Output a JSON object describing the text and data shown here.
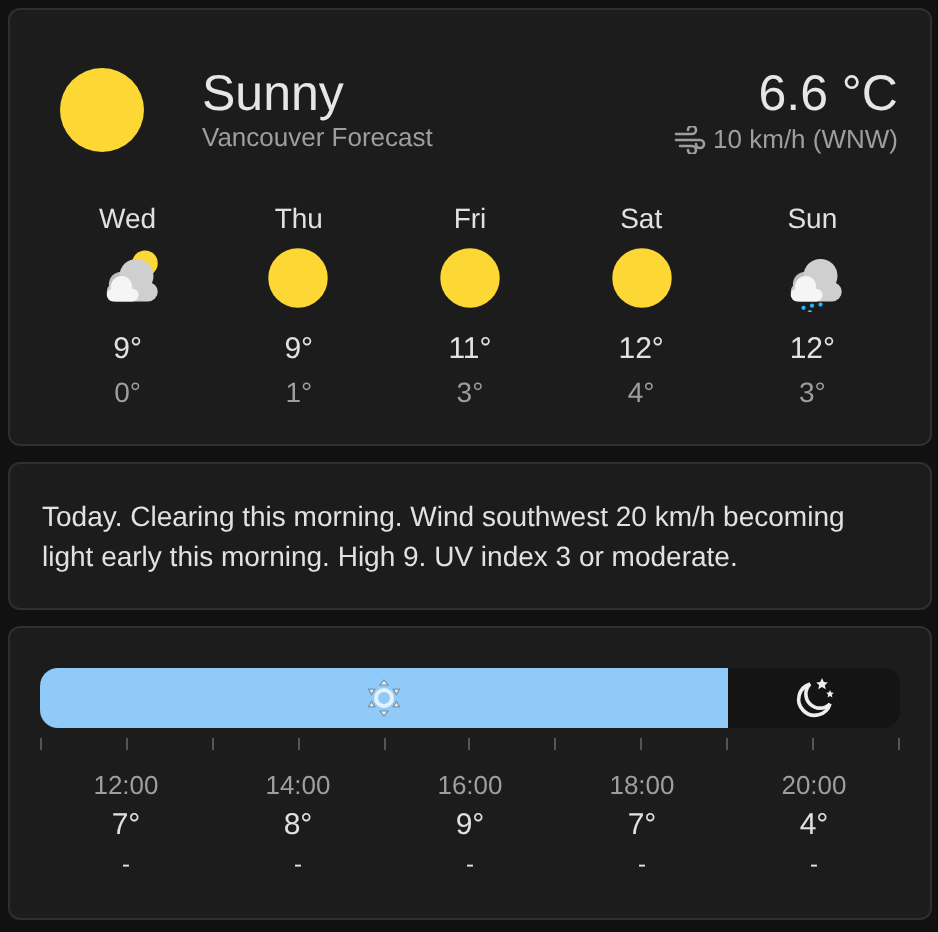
{
  "current": {
    "kind": "sunny",
    "condition": "Sunny",
    "location": "Vancouver Forecast",
    "temperature": "6.6 °C",
    "wind": "10 km/h (WNW)"
  },
  "daily": [
    {
      "day": "Wed",
      "kind": "partly-cloudy",
      "high": "9°",
      "low": "0°"
    },
    {
      "day": "Thu",
      "kind": "sunny",
      "high": "9°",
      "low": "1°"
    },
    {
      "day": "Fri",
      "kind": "sunny",
      "high": "11°",
      "low": "3°"
    },
    {
      "day": "Sat",
      "kind": "sunny",
      "high": "12°",
      "low": "4°"
    },
    {
      "day": "Sun",
      "kind": "rainy",
      "high": "12°",
      "low": "3°"
    }
  ],
  "summary": "Today. Clearing this morning. Wind southwest 20 km/h becoming light early this morning. High 9. UV index 3 or moderate.",
  "timeline": {
    "segments": [
      {
        "kind": "day",
        "level": 0.8
      },
      {
        "kind": "night"
      }
    ],
    "hours": [
      {
        "time": "12:00",
        "temperature": "7°",
        "precipitation": "-"
      },
      {
        "time": "14:00",
        "temperature": "8°",
        "precipitation": "-"
      },
      {
        "time": "16:00",
        "temperature": "9°",
        "precipitation": "-"
      },
      {
        "time": "18:00",
        "temperature": "7°",
        "precipitation": "-"
      },
      {
        "time": "20:00",
        "temperature": "4°",
        "precipitation": "-"
      }
    ]
  }
}
